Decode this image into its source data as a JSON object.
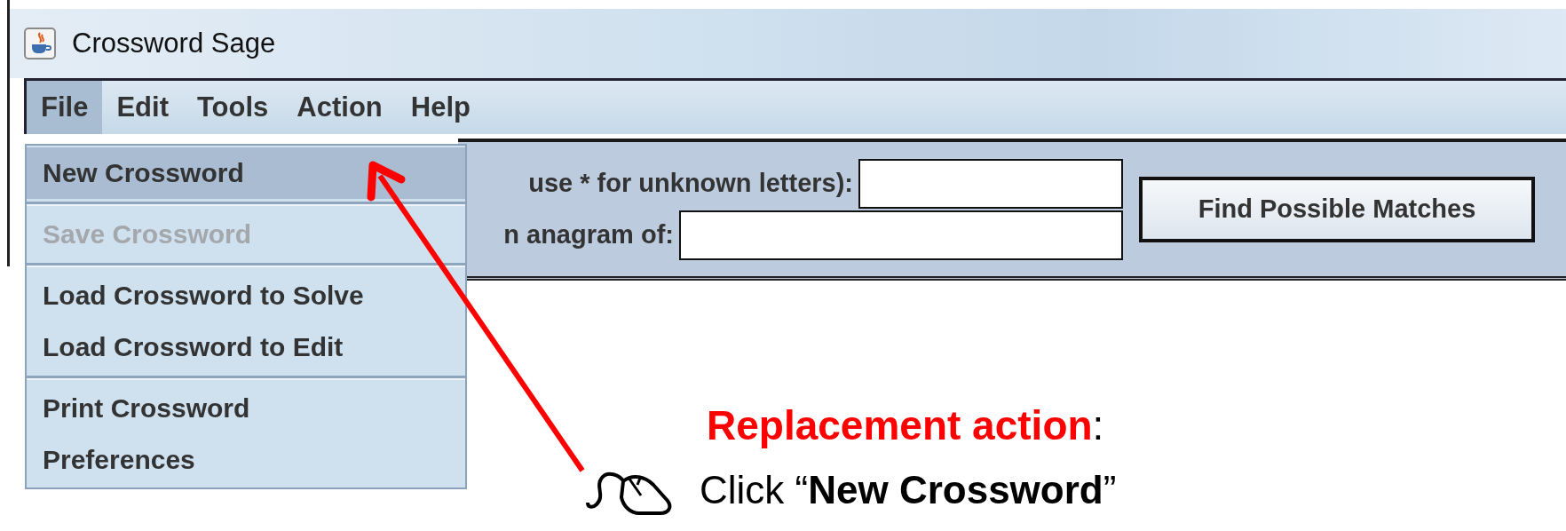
{
  "window": {
    "title": "Crossword Sage"
  },
  "menu_bar": [
    {
      "label": "File",
      "selected": true
    },
    {
      "label": "Edit",
      "selected": false
    },
    {
      "label": "Tools",
      "selected": false
    },
    {
      "label": "Action",
      "selected": false
    },
    {
      "label": "Help",
      "selected": false
    }
  ],
  "file_menu": [
    {
      "kind": "item",
      "label": "New Crossword",
      "selected": true,
      "disabled": false
    },
    {
      "kind": "separator"
    },
    {
      "kind": "item",
      "label": "Save Crossword",
      "selected": false,
      "disabled": true
    },
    {
      "kind": "separator"
    },
    {
      "kind": "item",
      "label": "Load Crossword to Solve",
      "selected": false,
      "disabled": false
    },
    {
      "kind": "item",
      "label": "Load Crossword to Edit",
      "selected": false,
      "disabled": false
    },
    {
      "kind": "separator"
    },
    {
      "kind": "item",
      "label": "Print Crossword",
      "selected": false,
      "disabled": false
    },
    {
      "kind": "item",
      "label": "Preferences",
      "selected": false,
      "disabled": false
    }
  ],
  "search_panel": {
    "rows": [
      {
        "label": "use * for unknown letters):"
      },
      {
        "label": "n anagram of:"
      }
    ],
    "button": "Find Possible Matches"
  },
  "annotation": {
    "heading": "**Replacement action**:",
    "instruction": "Click “**New Crossword**”"
  }
}
